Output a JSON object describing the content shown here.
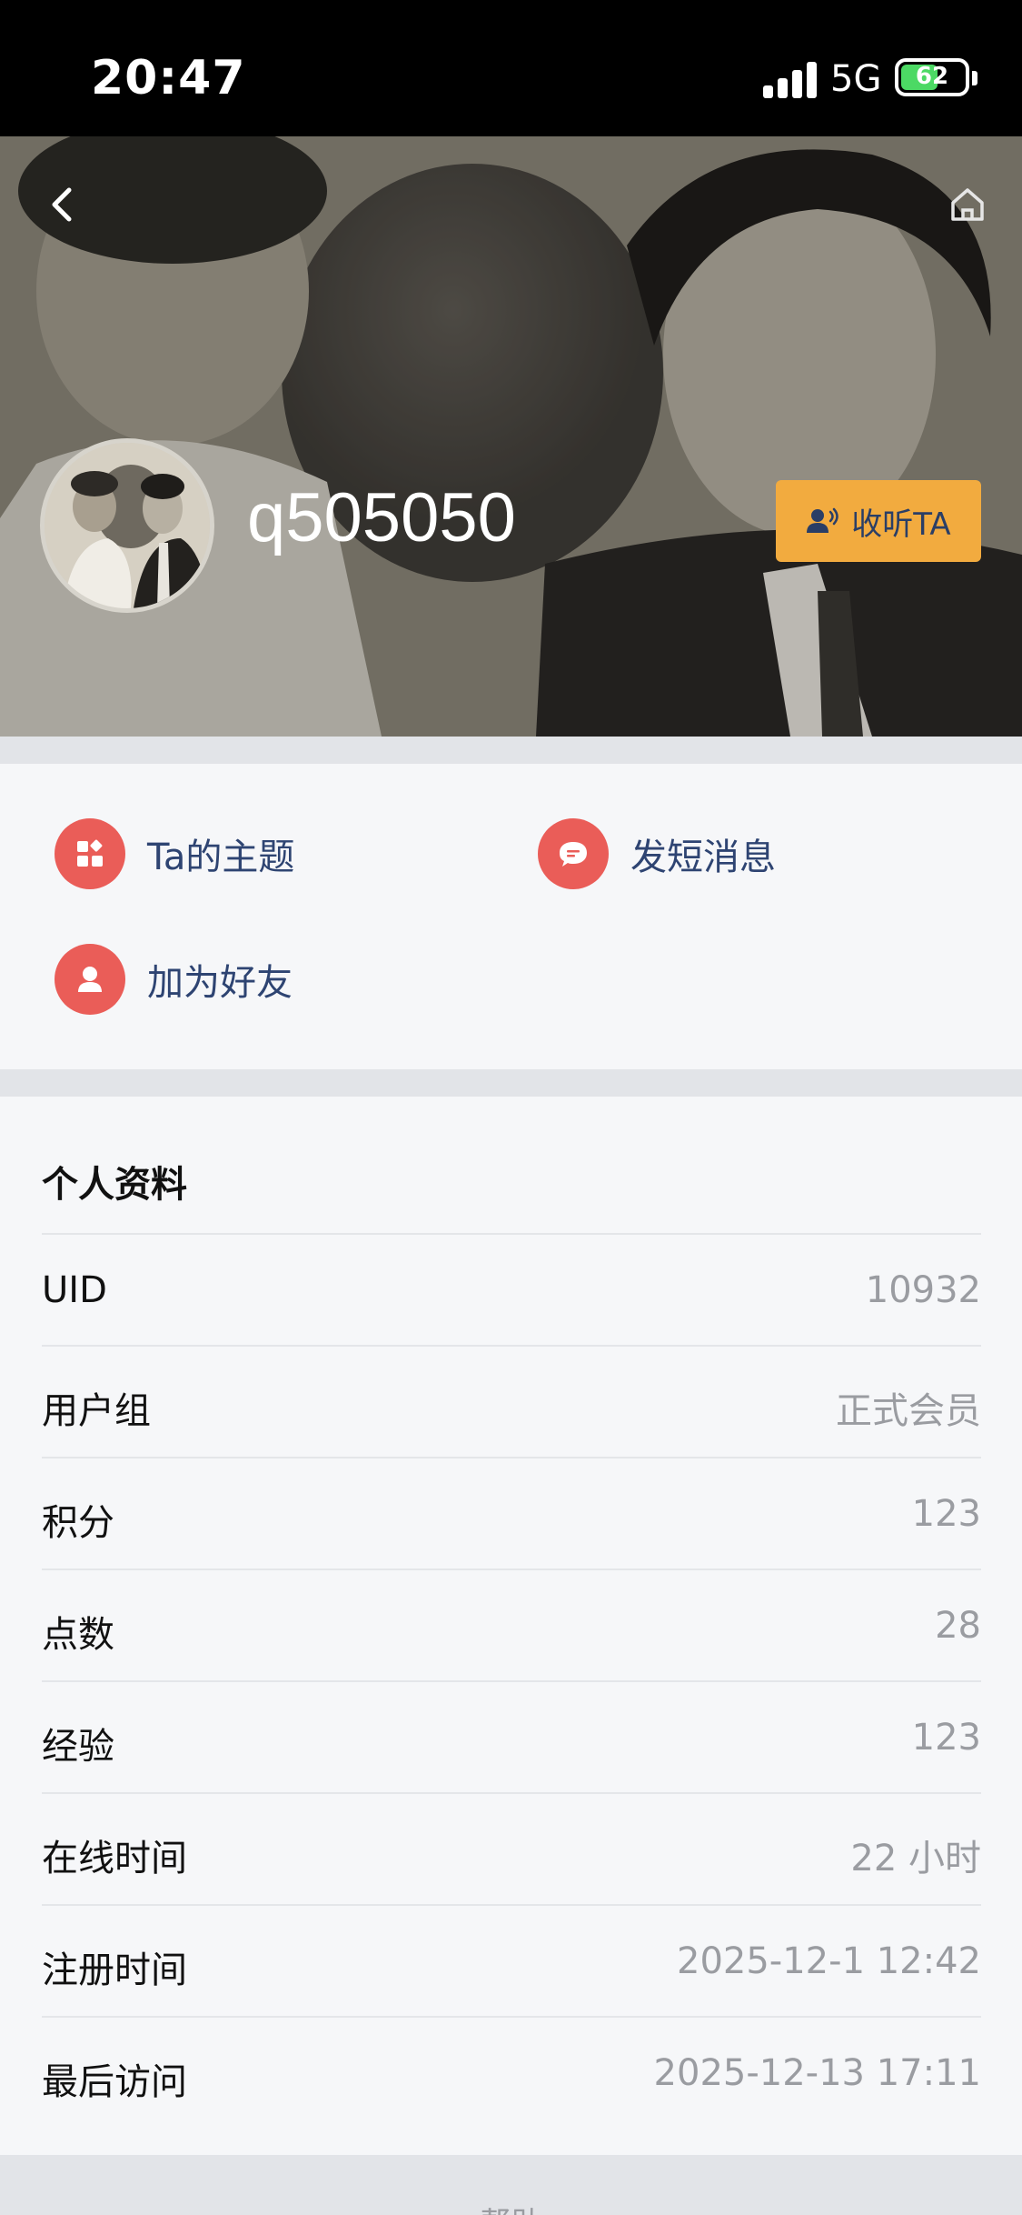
{
  "status_bar": {
    "time": "20:47",
    "network": "5G",
    "battery": "62",
    "battery_level": 0.62,
    "signal_icon": "signal-bars-icon"
  },
  "header": {
    "username": "q505050",
    "follow_label": "收听TA",
    "back_icon": "chevron-left-icon",
    "home_icon": "home-icon",
    "follow_icon": "people-voice-icon"
  },
  "actions": [
    {
      "label": "Ta的主题",
      "icon": "grid-icon"
    },
    {
      "label": "发短消息",
      "icon": "chat-bubble-icon"
    },
    {
      "label": "加为好友",
      "icon": "user-icon"
    }
  ],
  "profile": {
    "title": "个人资料",
    "rows": [
      {
        "label": "UID",
        "value": "10932"
      },
      {
        "label": "用户组",
        "value": "正式会员"
      },
      {
        "label": "积分",
        "value": "123"
      },
      {
        "label": "点数",
        "value": "28"
      },
      {
        "label": "经验",
        "value": "123"
      },
      {
        "label": "在线时间",
        "value": "22 小时"
      },
      {
        "label": "注册时间",
        "value": "2025-12-1 12:42"
      },
      {
        "label": "最后访问",
        "value": "2025-12-13 17:11"
      }
    ]
  },
  "footer": {
    "help_label": "帮助"
  },
  "colors": {
    "accent_red": "#ea5d58",
    "follow_orange": "#f2ab3f",
    "link_blue": "#2e4472",
    "muted_gray": "#9a9ca1"
  }
}
